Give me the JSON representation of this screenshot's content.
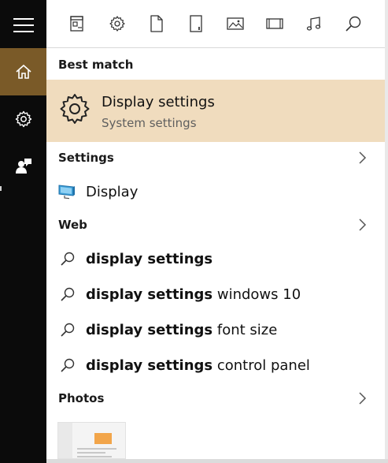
{
  "sidebar": {
    "items": [
      {
        "icon": "hamburger-menu-icon"
      },
      {
        "icon": "home-icon",
        "active": true
      },
      {
        "icon": "settings-gear-icon"
      },
      {
        "icon": "user-feedback-icon"
      }
    ]
  },
  "filters": {
    "icons": [
      "apps-icon",
      "settings-icon",
      "document-icon",
      "folder-device-icon",
      "photo-icon",
      "video-icon",
      "music-icon",
      "search-icon"
    ]
  },
  "best_match": {
    "header": "Best match",
    "title": "Display settings",
    "subtitle": "System settings"
  },
  "settings_section": {
    "header": "Settings",
    "items": [
      {
        "label": "Display"
      }
    ]
  },
  "web_section": {
    "header": "Web",
    "items": [
      {
        "bold": "display settings",
        "rest": ""
      },
      {
        "bold": "display settings",
        "rest": " windows 10"
      },
      {
        "bold": "display settings",
        "rest": " font size"
      },
      {
        "bold": "display settings",
        "rest": " control panel"
      }
    ]
  },
  "photos_section": {
    "header": "Photos"
  },
  "colors": {
    "sidebar_bg": "#0b0b0b",
    "active_accent": "#7a5a28",
    "best_match_highlight": "#f0dcbe"
  }
}
